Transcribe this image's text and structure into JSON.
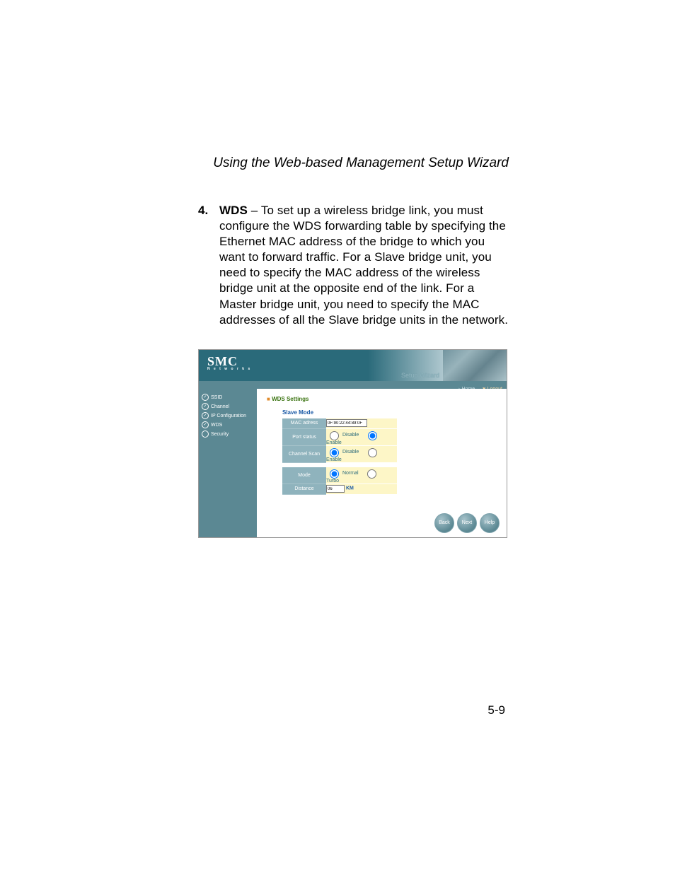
{
  "header": {
    "title": "Using the Web-based Management Setup Wizard"
  },
  "step": {
    "number": "4.",
    "heading": "WDS",
    "body": " – To set up a wireless bridge link, you must configure the WDS forwarding table by specifying the Ethernet MAC address of the bridge to which you want to forward traffic. For a Slave bridge unit, you need to specify the MAC address of the wireless bridge unit at the opposite end of the link. For a Master bridge unit, you need to specify the MAC addresses of all the Slave bridge units in the network."
  },
  "screenshot": {
    "logo": {
      "main": "SMC",
      "sub": "N e t w o r k s"
    },
    "banner_title": "Setup Wizard",
    "crumbs": {
      "home": "Home",
      "logout": "Logout"
    },
    "sidebar": {
      "items": [
        {
          "label": "SSID",
          "checked": true
        },
        {
          "label": "Channel",
          "checked": true
        },
        {
          "label": "IP Configuration",
          "checked": true
        },
        {
          "label": "WDS",
          "checked": true
        },
        {
          "label": "Security",
          "checked": false
        }
      ]
    },
    "panel": {
      "title": "WDS Settings",
      "subtitle": "Slave Mode",
      "rows1": [
        {
          "label": "MAC adress",
          "type": "text",
          "value": "0F:90:22:44:89:0F"
        },
        {
          "label": "Port status",
          "type": "radio",
          "opt1": "Disable",
          "opt2": "Enable",
          "selected": 2
        },
        {
          "label": "Channel Scan",
          "type": "radio",
          "opt1": "Disable",
          "opt2": "Enable",
          "selected": 1
        }
      ],
      "rows2": [
        {
          "label": "Mode",
          "type": "radio",
          "opt1": "Normal",
          "opt2": "Turbo",
          "selected": 1
        },
        {
          "label": "Distance",
          "type": "dist",
          "value": "06",
          "unit": "KM"
        }
      ]
    },
    "buttons": {
      "back": "Back",
      "next": "Next",
      "help": "Help"
    }
  },
  "footer": {
    "page_number": "5-9"
  }
}
